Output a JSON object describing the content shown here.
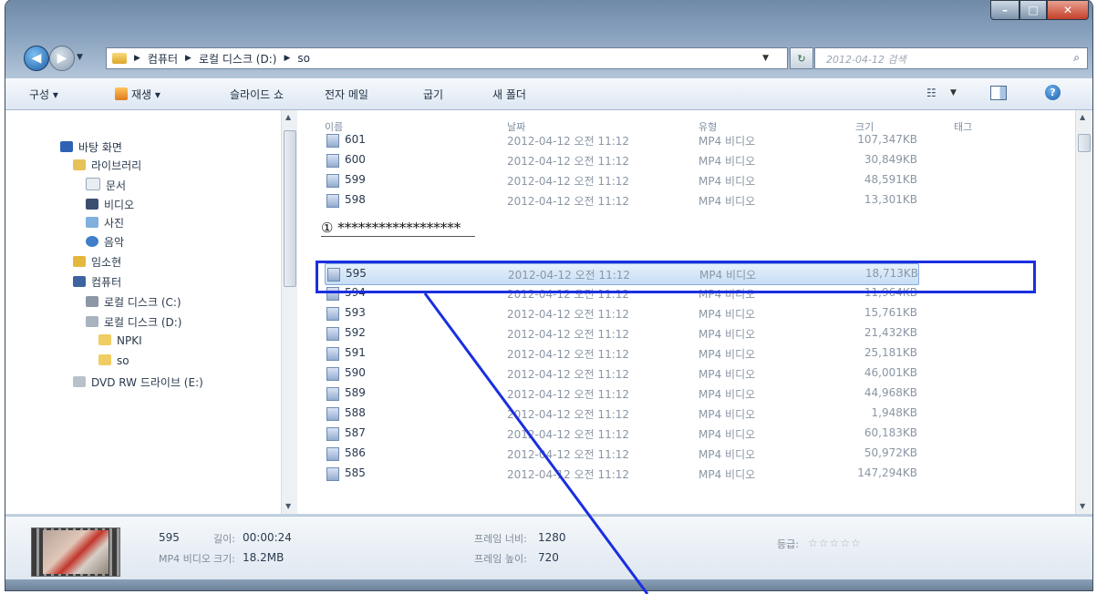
{
  "breadcrumbs": [
    "컴퓨터",
    "로컬 디스크 (D:)",
    "so"
  ],
  "search": {
    "placeholder": "2012-04-12 검색"
  },
  "toolbar": {
    "organize": "구성 ▾",
    "open": "재생 ▾",
    "slideshow": "슬라이드 쇼",
    "email": "전자 메일",
    "burn": "굽기",
    "new_folder": "새 폴더"
  },
  "nav": {
    "items": [
      {
        "label": "바탕 화면",
        "icon": "desktop-icon"
      },
      {
        "label": "라이브러리",
        "icon": "library-icon"
      },
      {
        "label": "문서",
        "icon": "document-icon"
      },
      {
        "label": "비디오",
        "icon": "video-icon"
      },
      {
        "label": "사진",
        "icon": "picture-icon"
      },
      {
        "label": "음악",
        "icon": "music-icon"
      },
      {
        "label": "임소현",
        "icon": "user-folder-icon"
      },
      {
        "label": "컴퓨터",
        "icon": "computer-icon"
      },
      {
        "label": "로컬 디스크 (C:)",
        "icon": "drive-icon"
      },
      {
        "label": "로컬 디스크 (D:)",
        "icon": "drive-icon"
      },
      {
        "label": "NPKI",
        "icon": "folder-icon"
      },
      {
        "label": "so",
        "icon": "folder-icon"
      },
      {
        "label": "DVD RW 드라이브 (E:)",
        "icon": "dvd-drive-icon"
      }
    ]
  },
  "columns": {
    "name": "이름",
    "date": "날짜",
    "type": "유형",
    "size": "크기",
    "tag": "태그"
  },
  "files_top": [
    {
      "name": "601",
      "date": "2012-04-12 오전 11:12",
      "type": "MP4 비디오",
      "size": "107,347KB"
    },
    {
      "name": "600",
      "date": "2012-04-12 오전 11:12",
      "type": "MP4 비디오",
      "size": "30,849KB"
    },
    {
      "name": "599",
      "date": "2012-04-12 오전 11:12",
      "type": "MP4 비디오",
      "size": "48,591KB"
    },
    {
      "name": "598",
      "date": "2012-04-12 오전 11:12",
      "type": "MP4 비디오",
      "size": "13,301KB"
    }
  ],
  "annotation": "① ******************",
  "files_bottom": [
    {
      "name": "595",
      "date": "2012-04-12 오전 11:12",
      "type": "MP4 비디오",
      "size": "18,713KB"
    },
    {
      "name": "594",
      "date": "2012-04-12 오전 11:12",
      "type": "MP4 비디오",
      "size": "11,964KB"
    },
    {
      "name": "593",
      "date": "2012-04-12 오전 11:12",
      "type": "MP4 비디오",
      "size": "15,761KB"
    },
    {
      "name": "592",
      "date": "2012-04-12 오전 11:12",
      "type": "MP4 비디오",
      "size": "21,432KB"
    },
    {
      "name": "591",
      "date": "2012-04-12 오전 11:12",
      "type": "MP4 비디오",
      "size": "25,181KB"
    },
    {
      "name": "590",
      "date": "2012-04-12 오전 11:12",
      "type": "MP4 비디오",
      "size": "46,001KB"
    },
    {
      "name": "589",
      "date": "2012-04-12 오전 11:12",
      "type": "MP4 비디오",
      "size": "44,968KB"
    },
    {
      "name": "588",
      "date": "2012-04-12 오전 11:12",
      "type": "MP4 비디오",
      "size": "1,948KB"
    },
    {
      "name": "587",
      "date": "2012-04-12 오전 11:12",
      "type": "MP4 비디오",
      "size": "60,183KB"
    },
    {
      "name": "586",
      "date": "2012-04-12 오전 11:12",
      "type": "MP4 비디오",
      "size": "50,972KB"
    },
    {
      "name": "585",
      "date": "2012-04-12 오전 11:12",
      "type": "MP4 비디오",
      "size": "147,294KB"
    }
  ],
  "details": {
    "name": "595",
    "type": "MP4 비디오",
    "length_label": "길이:",
    "length_value": "00:00:24",
    "size_label": "크기:",
    "size_value": "18.2MB",
    "width_label": "프레임 너비:",
    "width_value": "1280",
    "height_label": "프레임 높이:",
    "height_value": "720",
    "rating_label": "등급:",
    "rating_stars": "☆☆☆☆☆"
  },
  "colors": {
    "highlight_box": "#1a2fe0",
    "pointer_line": "#1a2fe0"
  }
}
